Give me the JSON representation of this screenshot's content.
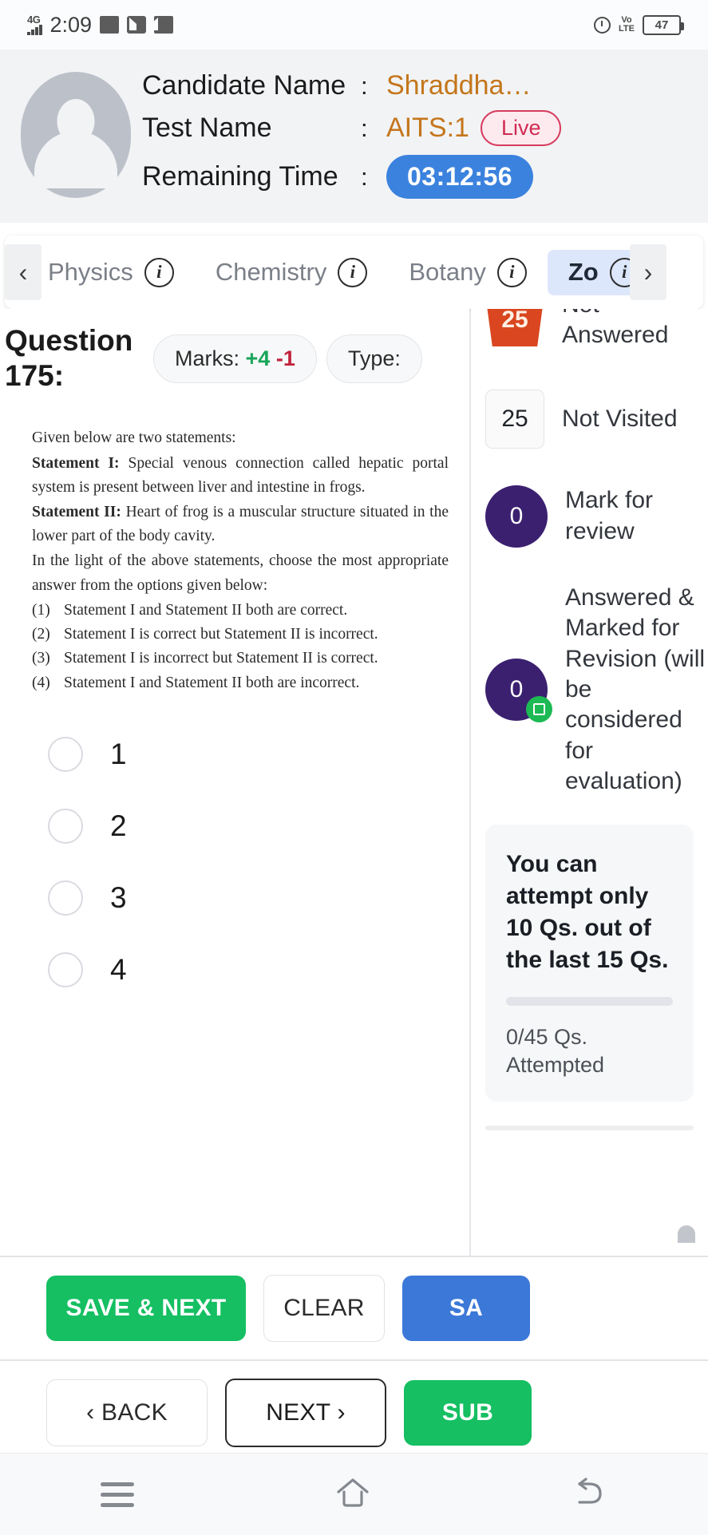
{
  "status_bar": {
    "network": "4G",
    "time": "2:09",
    "volte": "VoLTE",
    "battery": "47",
    "icons": [
      "image-notification-icon",
      "mail-icon",
      "app-notification-icon",
      "alarm-icon"
    ]
  },
  "header": {
    "rows": [
      {
        "label": "Candidate Name",
        "colon": ":",
        "value": "Shraddha…"
      },
      {
        "label": "Test Name",
        "colon": ":",
        "value": "AITS:1"
      },
      {
        "label": "Remaining Time",
        "colon": ":",
        "value": ""
      }
    ],
    "live_badge": "Live",
    "remaining_time": "03:12:56",
    "avatar_alt": "candidate-avatar"
  },
  "tabs": {
    "scroll_left": "‹",
    "scroll_right": "›",
    "items": [
      {
        "label": "Physics",
        "info": "i",
        "active": false
      },
      {
        "label": "Chemistry",
        "info": "i",
        "active": false
      },
      {
        "label": "Botany",
        "info": "i",
        "active": false
      },
      {
        "label": "Zo",
        "info": "i",
        "active": true
      }
    ]
  },
  "question": {
    "number_label": "Question 175:",
    "marks_prefix": "Marks:",
    "marks_positive": "+4",
    "marks_negative": "-1",
    "type_label": "Type:",
    "intro": "Given below are two statements:",
    "statement1_label": "Statement I:",
    "statement1_text": " Special venous connection called hepatic portal system is present between liver and intestine in frogs.",
    "statement2_label": "Statement II:",
    "statement2_text": " Heart of frog is a muscular structure situated in the lower part of the body cavity.",
    "closing": "In the light of the above statements, choose the most appropriate answer from the options given below:",
    "choices": [
      {
        "num": "(1)",
        "text": "Statement I and Statement II both are correct."
      },
      {
        "num": "(2)",
        "text": "Statement I is correct but Statement II is incorrect."
      },
      {
        "num": "(3)",
        "text": "Statement I is incorrect but Statement II is correct."
      },
      {
        "num": "(4)",
        "text": "Statement I and Statement II both are incorrect."
      }
    ],
    "options": [
      {
        "label": "1",
        "selected": false
      },
      {
        "label": "2",
        "selected": false
      },
      {
        "label": "3",
        "selected": false
      },
      {
        "label": "4",
        "selected": false
      }
    ]
  },
  "actions": {
    "save_next": "SAVE & NEXT",
    "clear": "CLEAR",
    "save_blue": "SA",
    "back": "BACK",
    "back_chevron": "‹",
    "next": "NEXT",
    "next_chevron": "›",
    "submit": "SUB"
  },
  "legend": {
    "items": [
      {
        "count": "25",
        "label": "Not Answered",
        "style": "not-answered",
        "color": "#d9461f"
      },
      {
        "count": "25",
        "label": "Not Visited",
        "style": "not-visited",
        "color": "#fafafa"
      },
      {
        "count": "0",
        "label": "Mark for review",
        "style": "marked",
        "color": "#3b2070"
      },
      {
        "count": "0",
        "label": "Answered & Marked for Revision (will be considered for evaluation)",
        "style": "answered-marked",
        "color": "#3b2070"
      }
    ]
  },
  "info_card": {
    "message": "You can attempt only 10 Qs. out of the last 15 Qs.",
    "progress_percent": 0,
    "attempted": "0/45 Qs. Attempted"
  },
  "navbar": {
    "items": [
      "menu-icon",
      "home-icon",
      "back-icon"
    ]
  },
  "colors": {
    "accent_orange": "#c4761b",
    "timer_blue": "#3b82de",
    "live_red": "#d02b52",
    "green": "#15bf62",
    "purple": "#3b2070",
    "not_answered": "#d9461f",
    "tab_active_bg": "#dde7fb"
  }
}
